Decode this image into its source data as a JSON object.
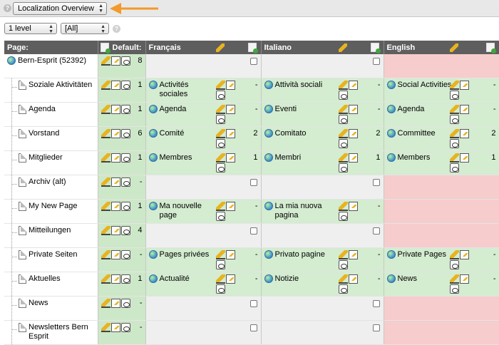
{
  "toolbar": {
    "function_select": "Localization Overview",
    "depth_select": "1 level",
    "language_select": "[All]"
  },
  "columns": {
    "page": "Page:",
    "default": "Default:",
    "lang1": "Français",
    "lang2": "Italiano",
    "lang3": "English"
  },
  "rows": [
    {
      "title": "Bern-Esprit (52392)",
      "def": "8",
      "fr": "",
      "it": "",
      "en": ""
    },
    {
      "title": "Soziale Aktivitäten",
      "def": "1",
      "fr": "Activités sociales",
      "fr_n": "-",
      "it": "Attività sociali",
      "it_n": "-",
      "en": "Social Activities",
      "en_n": "-"
    },
    {
      "title": "Agenda",
      "def": "1",
      "fr": "Agenda",
      "fr_n": "-",
      "it": "Eventi",
      "it_n": "-",
      "en": "Agenda",
      "en_n": "-"
    },
    {
      "title": "Vorstand",
      "def": "6",
      "fr": "Comité",
      "fr_n": "2",
      "it": "Comitato",
      "it_n": "2",
      "en": "Committee",
      "en_n": "2"
    },
    {
      "title": "Mitglieder",
      "def": "1",
      "fr": "Membres",
      "fr_n": "1",
      "it": "Membri",
      "it_n": "1",
      "en": "Members",
      "en_n": "1"
    },
    {
      "title": "Archiv (alt)",
      "def": "-",
      "fr": "",
      "it": "",
      "en": ""
    },
    {
      "title": "My New Page",
      "def": "1",
      "fr": "Ma nouvelle page",
      "fr_n": "-",
      "it": "La mia nuova pagina",
      "it_n": "-",
      "en": ""
    },
    {
      "title": "Mitteilungen",
      "def": "4",
      "fr": "",
      "it": "",
      "en": ""
    },
    {
      "title": "Private Seiten",
      "def": "-",
      "fr": "Pages privées",
      "fr_n": "-",
      "it": "Privato pagine",
      "it_n": "-",
      "en": "Private Pages",
      "en_n": "-"
    },
    {
      "title": "Aktuelles",
      "def": "1",
      "fr": "Actualité",
      "fr_n": "-",
      "it": "Notizie",
      "it_n": "-",
      "en": "News",
      "en_n": "-"
    },
    {
      "title": "News",
      "def": "-",
      "fr": "",
      "it": "",
      "en": ""
    },
    {
      "title": "Newsletters Bern Esprit",
      "def": "-",
      "fr": "",
      "it": "",
      "en": ""
    }
  ],
  "colors": {
    "accent_arrow": "#f39a2a",
    "header_bg": "#5e5e5e",
    "translated_bg": "#d4ecd0",
    "missing_bg": "#f6cccc",
    "untranslated_bg": "#efefef"
  }
}
